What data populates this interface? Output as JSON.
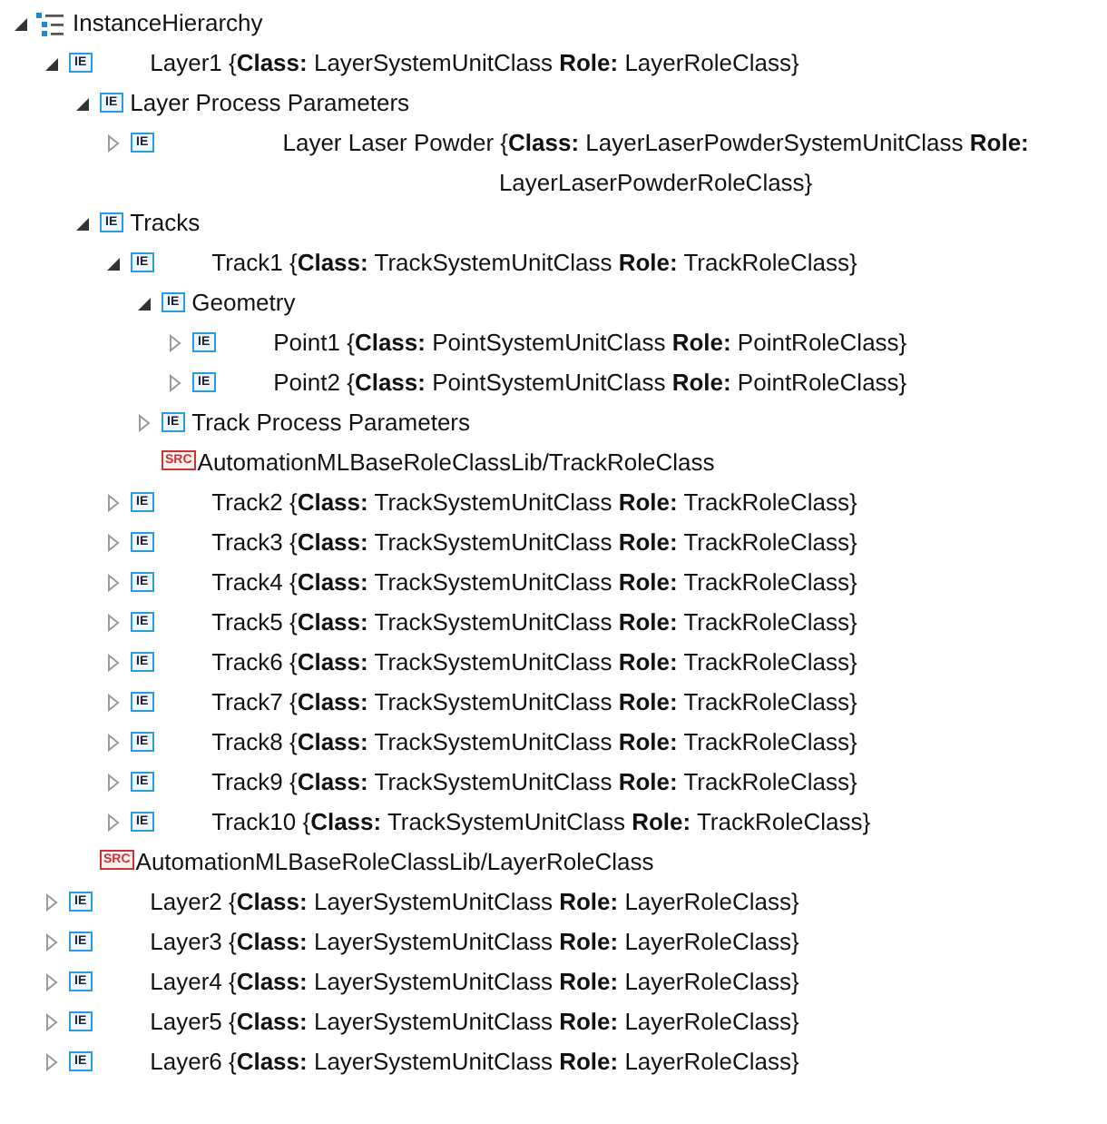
{
  "tree": {
    "kind": "root",
    "label": "InstanceHierarchy",
    "expanded": true,
    "children": [
      {
        "kind": "element",
        "badge": "IE",
        "label": "Layer1 {**Class:** LayerSystemUnitClass **Role:** LayerRoleClass}",
        "expanded": true,
        "children": [
          {
            "kind": "element",
            "badge": "IE",
            "label": "Layer Process Parameters",
            "expanded": true,
            "children": [
              {
                "kind": "element",
                "badge": "IE",
                "label": "Layer Laser Powder {**Class:** LayerLaserPowderSystemUnitClass **Role:** LayerLaserPowderRoleClass}",
                "expanded": false
              }
            ]
          },
          {
            "kind": "element",
            "badge": "IE",
            "label": "Tracks",
            "expanded": true,
            "children": [
              {
                "kind": "element",
                "badge": "IE",
                "label": "Track1 {**Class:** TrackSystemUnitClass **Role:** TrackRoleClass}",
                "expanded": true,
                "children": [
                  {
                    "kind": "element",
                    "badge": "IE",
                    "label": "Geometry",
                    "expanded": true,
                    "children": [
                      {
                        "kind": "element",
                        "badge": "IE",
                        "label": "Point1 {**Class:** PointSystemUnitClass **Role:** PointRoleClass}",
                        "expanded": false
                      },
                      {
                        "kind": "element",
                        "badge": "IE",
                        "label": "Point2 {**Class:** PointSystemUnitClass **Role:** PointRoleClass}",
                        "expanded": false
                      }
                    ]
                  },
                  {
                    "kind": "element",
                    "badge": "IE",
                    "label": "Track Process Parameters",
                    "expanded": false
                  },
                  {
                    "kind": "role",
                    "badge": "SRC",
                    "label": "AutomationMLBaseRoleClassLib/TrackRoleClass"
                  }
                ]
              },
              {
                "kind": "element",
                "badge": "IE",
                "label": "Track2 {**Class:** TrackSystemUnitClass **Role:** TrackRoleClass}",
                "expanded": false
              },
              {
                "kind": "element",
                "badge": "IE",
                "label": "Track3 {**Class:** TrackSystemUnitClass **Role:** TrackRoleClass}",
                "expanded": false
              },
              {
                "kind": "element",
                "badge": "IE",
                "label": "Track4 {**Class:** TrackSystemUnitClass **Role:** TrackRoleClass}",
                "expanded": false
              },
              {
                "kind": "element",
                "badge": "IE",
                "label": "Track5 {**Class:** TrackSystemUnitClass **Role:** TrackRoleClass}",
                "expanded": false
              },
              {
                "kind": "element",
                "badge": "IE",
                "label": "Track6 {**Class:** TrackSystemUnitClass **Role:** TrackRoleClass}",
                "expanded": false
              },
              {
                "kind": "element",
                "badge": "IE",
                "label": "Track7 {**Class:** TrackSystemUnitClass **Role:** TrackRoleClass}",
                "expanded": false
              },
              {
                "kind": "element",
                "badge": "IE",
                "label": "Track8 {**Class:** TrackSystemUnitClass **Role:** TrackRoleClass}",
                "expanded": false
              },
              {
                "kind": "element",
                "badge": "IE",
                "label": "Track9 {**Class:** TrackSystemUnitClass **Role:** TrackRoleClass}",
                "expanded": false
              },
              {
                "kind": "element",
                "badge": "IE",
                "label": "Track10 {**Class:** TrackSystemUnitClass **Role:** TrackRoleClass}",
                "expanded": false
              }
            ]
          },
          {
            "kind": "role",
            "badge": "SRC",
            "label": "AutomationMLBaseRoleClassLib/LayerRoleClass"
          }
        ]
      },
      {
        "kind": "element",
        "badge": "IE",
        "label": "Layer2 {**Class:** LayerSystemUnitClass **Role:** LayerRoleClass}",
        "expanded": false
      },
      {
        "kind": "element",
        "badge": "IE",
        "label": "Layer3 {**Class:** LayerSystemUnitClass **Role:** LayerRoleClass}",
        "expanded": false
      },
      {
        "kind": "element",
        "badge": "IE",
        "label": "Layer4 {**Class:** LayerSystemUnitClass **Role:** LayerRoleClass}",
        "expanded": false
      },
      {
        "kind": "element",
        "badge": "IE",
        "label": "Layer5 {**Class:** LayerSystemUnitClass **Role:** LayerRoleClass}",
        "expanded": false
      },
      {
        "kind": "element",
        "badge": "IE",
        "label": "Layer6 {**Class:** LayerSystemUnitClass **Role:** LayerRoleClass}",
        "expanded": false
      }
    ]
  }
}
